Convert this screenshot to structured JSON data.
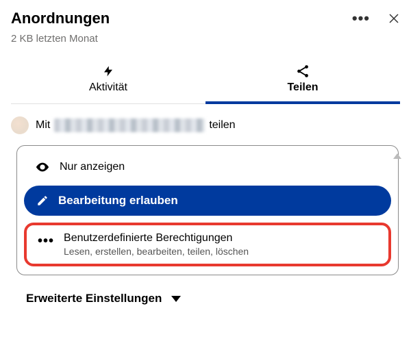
{
  "header": {
    "title": "Anordnungen",
    "subtitle": "2 KB letzten Monat"
  },
  "tabs": {
    "activity": "Aktivität",
    "share": "Teilen"
  },
  "share_row": {
    "prefix": "Mit",
    "suffix": "teilen"
  },
  "permissions": {
    "view": "Nur anzeigen",
    "edit": "Bearbeitung erlauben",
    "custom": {
      "label": "Benutzerdefinierte Berechtigungen",
      "desc": "Lesen, erstellen, bearbeiten, teilen, löschen"
    }
  },
  "advanced": "Erweiterte Einstellungen"
}
